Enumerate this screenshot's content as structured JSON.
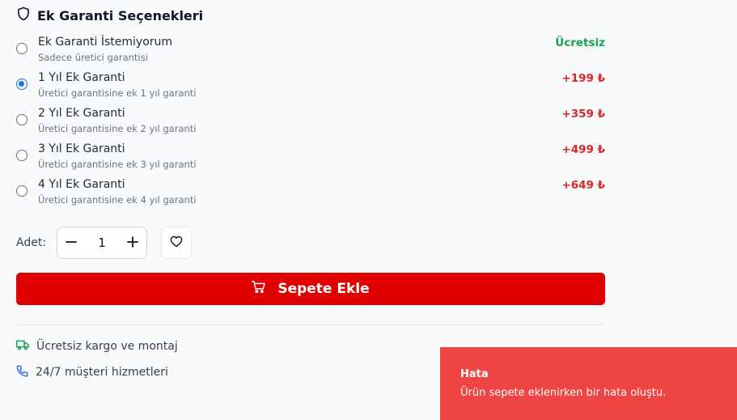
{
  "warranty": {
    "title": "Ek Garanti Seçenekleri",
    "options": [
      {
        "title": "Ek Garanti İstemiyorum",
        "subtitle": "Sadece üretici garantisi",
        "price": "Ücretsiz",
        "selected": false
      },
      {
        "title": "1 Yıl Ek Garanti",
        "subtitle": "Üretici garantisine ek 1 yıl garanti",
        "price": "+199 ₺",
        "selected": true
      },
      {
        "title": "2 Yıl Ek Garanti",
        "subtitle": "Üretici garantisine ek 2 yıl garanti",
        "price": "+359 ₺",
        "selected": false
      },
      {
        "title": "3 Yıl Ek Garanti",
        "subtitle": "Üretici garantisine ek 3 yıl garanti",
        "price": "+499 ₺",
        "selected": false
      },
      {
        "title": "4 Yıl Ek Garanti",
        "subtitle": "Üretici garantisine ek 4 yıl garanti",
        "price": "+649 ₺",
        "selected": false
      }
    ]
  },
  "quantity": {
    "label": "Adet:",
    "value": "1"
  },
  "add_to_cart": {
    "label": "Sepete Ekle"
  },
  "features": {
    "shipping": "Ücretsiz kargo ve montaj",
    "support": "24/7 müşteri hizmetleri"
  },
  "toast": {
    "title": "Hata",
    "message": "Ürün sepete eklenirken bir hata oluştu."
  },
  "colors": {
    "accent_red": "#e00000",
    "price_red": "#dc2626",
    "free_green": "#16a34a",
    "radio_blue": "#1a73e8",
    "toast_bg": "#ef4444"
  },
  "icons": {
    "section": "shield-icon",
    "decrease": "minus-icon",
    "increase": "plus-icon",
    "favorite": "heart-icon",
    "cart": "cart-icon",
    "shipping": "truck-icon",
    "support": "phone-icon"
  }
}
